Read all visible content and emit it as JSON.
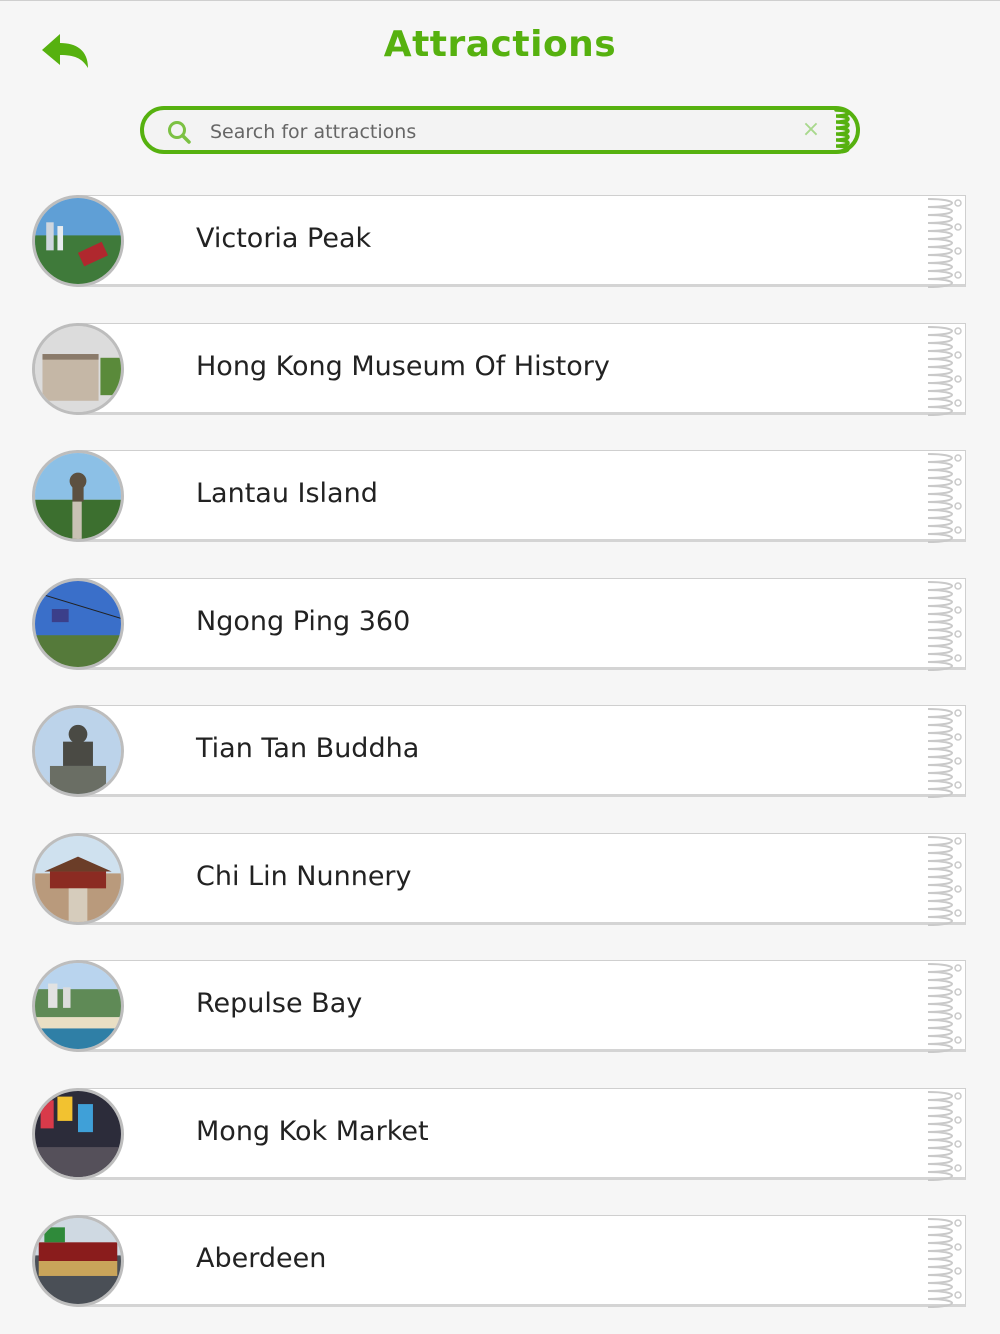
{
  "header": {
    "title": "Attractions",
    "back_icon": "back-arrow-icon"
  },
  "search": {
    "placeholder": "Search for attractions",
    "value": "",
    "clear_symbol": "×"
  },
  "colors": {
    "accent": "#56b10f",
    "background": "#f6f6f6",
    "card": "#ffffff"
  },
  "attractions": [
    {
      "name": "Victoria Peak",
      "image": "victoria-peak-photo"
    },
    {
      "name": "Hong Kong Museum Of History",
      "image": "museum-photo"
    },
    {
      "name": "Lantau Island",
      "image": "lantau-island-photo"
    },
    {
      "name": "Ngong Ping 360",
      "image": "ngong-ping-photo"
    },
    {
      "name": "Tian Tan Buddha",
      "image": "buddha-photo"
    },
    {
      "name": "Chi Lin Nunnery",
      "image": "nunnery-photo"
    },
    {
      "name": "Repulse Bay",
      "image": "repulse-bay-photo"
    },
    {
      "name": "Mong Kok Market",
      "image": "mong-kok-photo"
    },
    {
      "name": "Aberdeen",
      "image": "aberdeen-photo"
    }
  ]
}
